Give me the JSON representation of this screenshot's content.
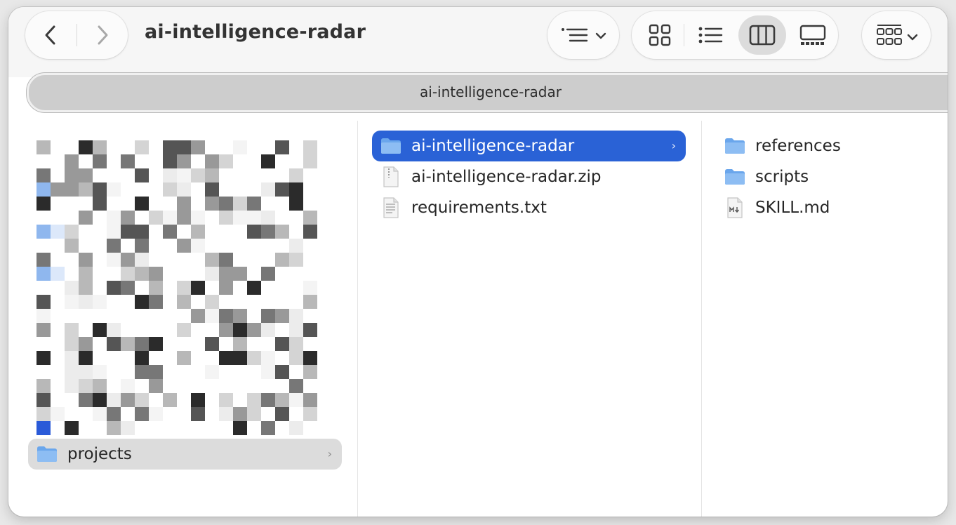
{
  "window": {
    "title": "ai-intelligence-radar"
  },
  "toolbar": {
    "back_icon": "chevron-left-icon",
    "forward_icon": "chevron-right-icon",
    "group_icon": "list-group-icon",
    "views": [
      {
        "name": "icon-view",
        "icon": "grid-icon",
        "active": false
      },
      {
        "name": "list-view",
        "icon": "list-icon",
        "active": false
      },
      {
        "name": "column-view",
        "icon": "columns-icon",
        "active": true
      },
      {
        "name": "gallery-view",
        "icon": "gallery-icon",
        "active": false
      }
    ],
    "more_icon": "more-grid-icon"
  },
  "pathbar": {
    "text": "ai-intelligence-radar"
  },
  "column1": {
    "items": [
      {
        "label": "projects",
        "icon": "folder-icon",
        "highlighted": true
      }
    ]
  },
  "column2": {
    "items": [
      {
        "label": "ai-intelligence-radar",
        "icon": "folder-icon",
        "selected": true
      },
      {
        "label": "ai-intelligence-radar.zip",
        "icon": "zip-file-icon"
      },
      {
        "label": "requirements.txt",
        "icon": "text-file-icon"
      }
    ]
  },
  "column3": {
    "items": [
      {
        "label": "references",
        "icon": "folder-icon"
      },
      {
        "label": "scripts",
        "icon": "folder-icon"
      },
      {
        "label": "SKILL.md",
        "icon": "markdown-file-icon"
      }
    ]
  },
  "colors": {
    "selection": "#2a62d6",
    "folder": "#6aa6ec"
  }
}
